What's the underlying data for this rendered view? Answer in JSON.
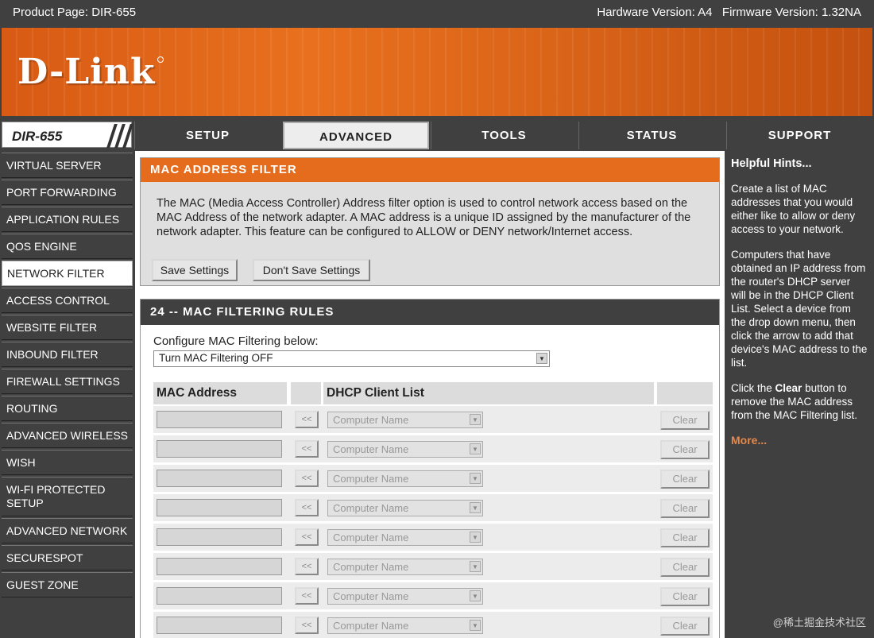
{
  "topbar": {
    "product": "Product Page: DIR-655",
    "versions": "Hardware Version: A4   Firmware Version: 1.32NA"
  },
  "brand": {
    "logo": "D-Link"
  },
  "nav": {
    "model": "DIR-655",
    "tabs": [
      "SETUP",
      "ADVANCED",
      "TOOLS",
      "STATUS",
      "SUPPORT"
    ],
    "active_tab": "ADVANCED"
  },
  "sidebar": {
    "items": [
      "VIRTUAL SERVER",
      "PORT FORWARDING",
      "APPLICATION RULES",
      "QOS ENGINE",
      "NETWORK FILTER",
      "ACCESS CONTROL",
      "WEBSITE FILTER",
      "INBOUND FILTER",
      "FIREWALL SETTINGS",
      "ROUTING",
      "ADVANCED WIRELESS",
      "WISH",
      "WI-FI PROTECTED SETUP",
      "ADVANCED NETWORK",
      "SECURESPOT",
      "GUEST ZONE"
    ],
    "active_item": "NETWORK FILTER"
  },
  "filter_panel": {
    "title": "MAC ADDRESS FILTER",
    "description": "The MAC (Media Access Controller) Address filter option is used to control network access based on the MAC Address of the network adapter. A MAC address is a unique ID assigned by the manufacturer of the network adapter. This feature can be configured to ALLOW or DENY network/Internet access.",
    "save_label": "Save Settings",
    "dont_save_label": "Don't Save Settings"
  },
  "rules_panel": {
    "title": "24 -- MAC FILTERING RULES",
    "config_label": "Configure MAC Filtering below:",
    "mode_value": "Turn MAC Filtering OFF",
    "headers": {
      "mac": "MAC Address",
      "dhcp": "DHCP Client List"
    },
    "arrow_label": "<<",
    "client_placeholder": "Computer Name",
    "clear_label": "Clear",
    "rows": [
      {
        "mac": "",
        "client": "Computer Name"
      },
      {
        "mac": "",
        "client": "Computer Name"
      },
      {
        "mac": "",
        "client": "Computer Name"
      },
      {
        "mac": "",
        "client": "Computer Name"
      },
      {
        "mac": "",
        "client": "Computer Name"
      },
      {
        "mac": "",
        "client": "Computer Name"
      },
      {
        "mac": "",
        "client": "Computer Name"
      },
      {
        "mac": "",
        "client": "Computer Name"
      }
    ]
  },
  "hints": {
    "title": "Helpful Hints...",
    "p1": "Create a list of MAC addresses that you would either like to allow or deny access to your network.",
    "p2": "Computers that have obtained an IP address from the router's DHCP server will be in the DHCP Client List. Select a device from the drop down menu, then click the arrow to add that device's MAC address to the list.",
    "p3_before": "Click the ",
    "p3_bold": "Clear",
    "p3_after": " button to remove the MAC address from the MAC Filtering list.",
    "more": "More..."
  },
  "watermark": "@稀土掘金技术社区",
  "colors": {
    "orange": "#e46c1c",
    "dark": "#404040",
    "link": "#e4884a"
  },
  "icons": {
    "dropdown": "chevron-down-icon",
    "add_arrow": "double-left-arrow-icon"
  }
}
